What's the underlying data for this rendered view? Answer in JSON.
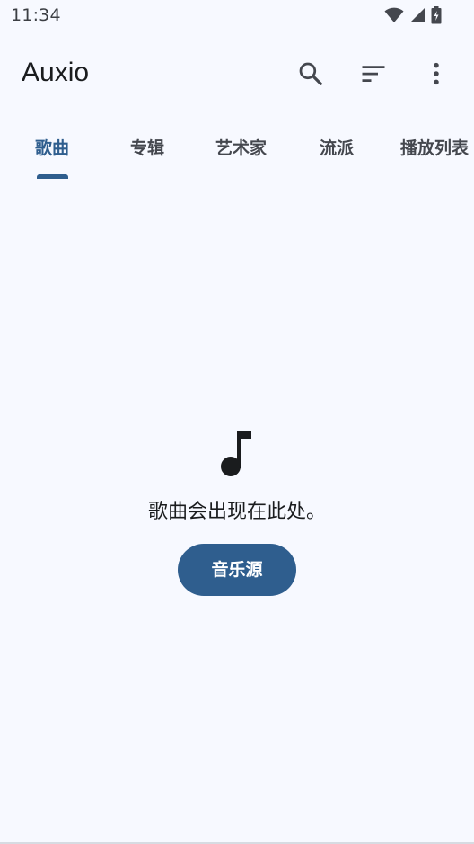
{
  "status_bar": {
    "time": "11:34",
    "icons": [
      "wifi-icon",
      "signal-icon",
      "battery-icon"
    ]
  },
  "app_bar": {
    "title": "Auxio",
    "actions": [
      {
        "name": "search-icon"
      },
      {
        "name": "sort-icon"
      },
      {
        "name": "more-vert-icon"
      }
    ]
  },
  "tabs": [
    {
      "label": "歌曲",
      "active": true
    },
    {
      "label": "专辑",
      "active": false
    },
    {
      "label": "艺术家",
      "active": false
    },
    {
      "label": "流派",
      "active": false
    },
    {
      "label": "播放列表",
      "active": false
    }
  ],
  "empty_state": {
    "icon": "music-note-icon",
    "message": "歌曲会出现在此处。",
    "button_label": "音乐源"
  },
  "colors": {
    "accent": "#2f5e8e",
    "background": "#f7f9ff",
    "text": "#1a1c1e"
  }
}
